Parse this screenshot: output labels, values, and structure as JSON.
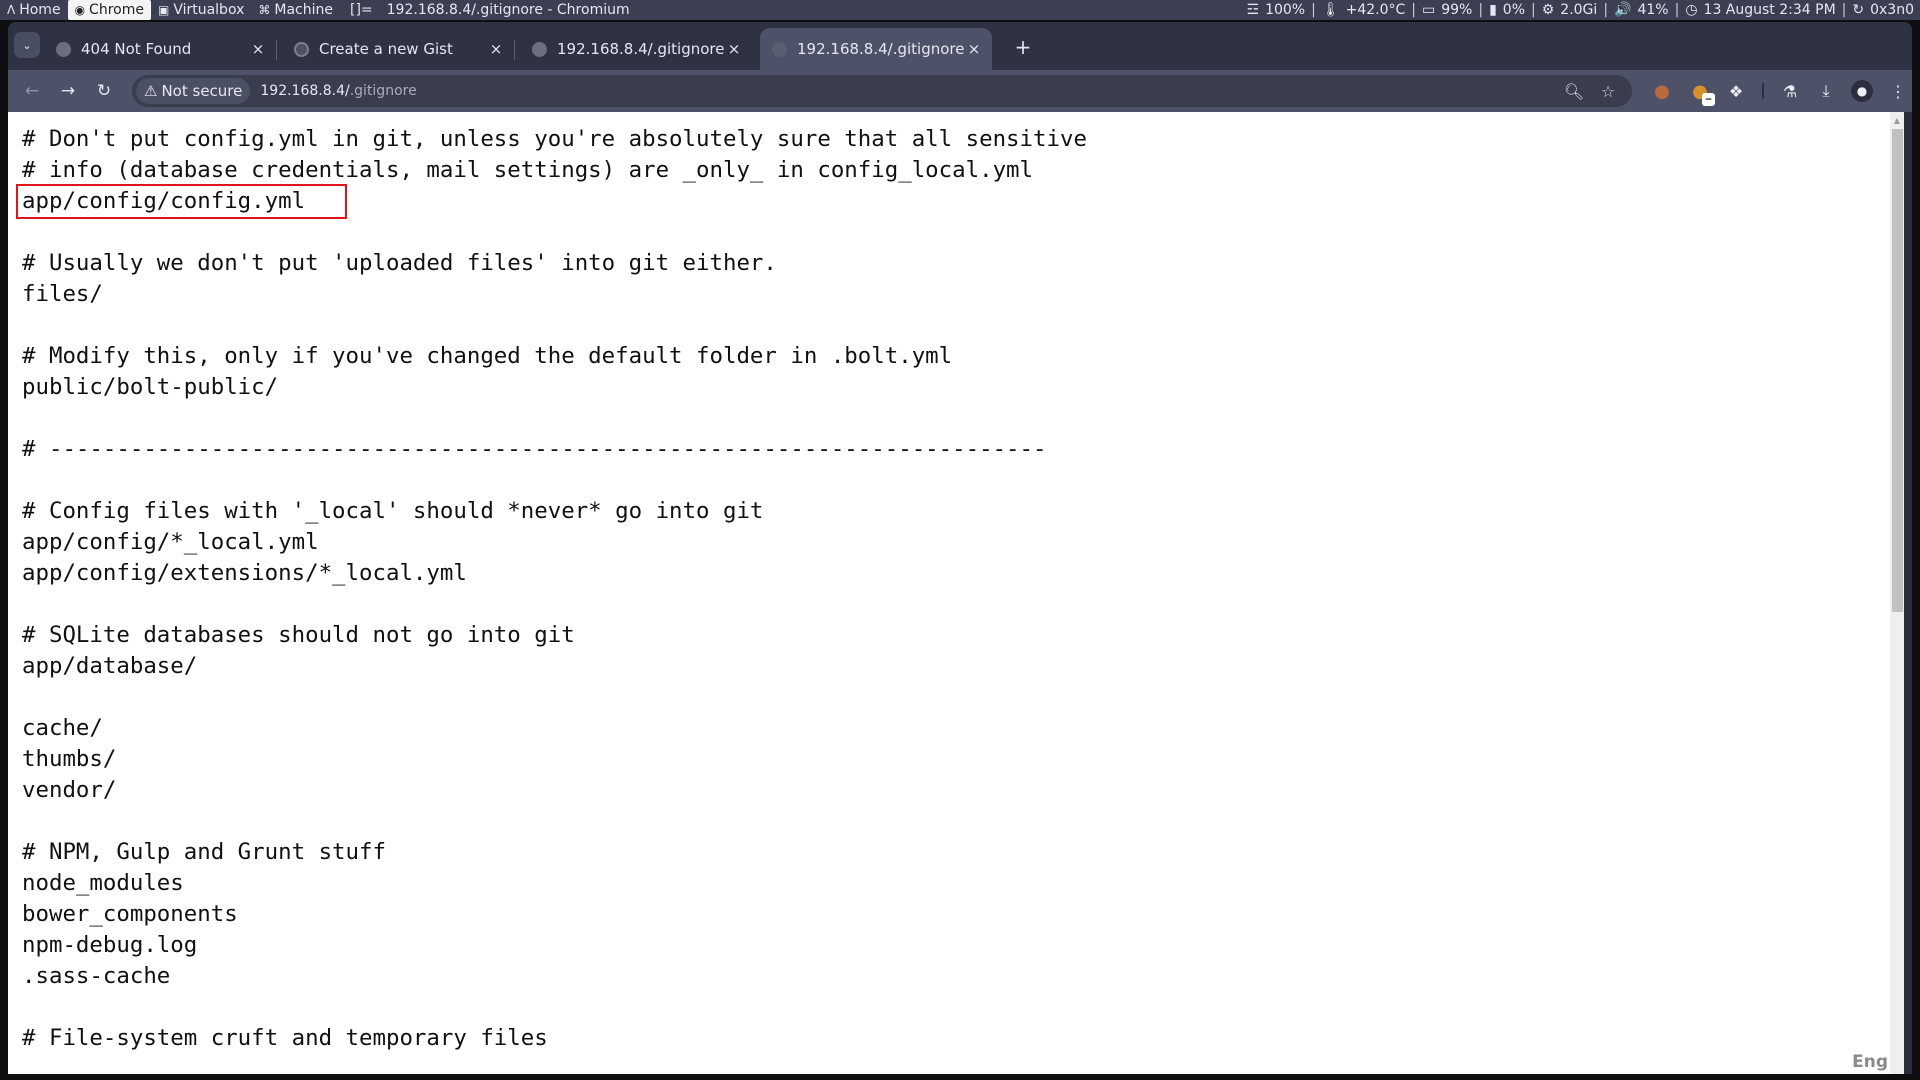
{
  "system_bar": {
    "workspaces": [
      {
        "icon": "arch-icon",
        "glyph": "Λ",
        "label": "Home",
        "active": false
      },
      {
        "icon": "chrome-icon",
        "glyph": "◉",
        "label": "Chrome",
        "active": true
      },
      {
        "icon": "monitor-icon",
        "glyph": "🖳",
        "label": "Virtualbox",
        "active": false
      },
      {
        "icon": "machine-icon",
        "glyph": "⌘",
        "label": "Machine",
        "active": false
      }
    ],
    "layout_symbol": "[]=",
    "window_title": "192.168.8.4/.gitignore - Chromium",
    "status": {
      "wifi": "100%",
      "temperature": "+42.0°C",
      "battery": "99%",
      "cpu": "0%",
      "memory": "2.0Gi",
      "volume": "41%",
      "datetime": "13 August 2:34 PM",
      "user": "0x3n0"
    }
  },
  "browser": {
    "tabs": [
      {
        "title": "404 Not Found",
        "favicon": "globe",
        "active": false
      },
      {
        "title": "Create a new Gist",
        "favicon": "github",
        "active": false
      },
      {
        "title": "192.168.8.4/.gitignore",
        "favicon": "globe",
        "active": false
      },
      {
        "title": "192.168.8.4/.gitignore",
        "favicon": "globe",
        "active": true
      }
    ],
    "new_tab_label": "+",
    "close_label": "×",
    "security_chip": "Not secure",
    "url_host": "192.168.8.4/",
    "url_path": ".gitignore"
  },
  "document": {
    "highlighted_line_index": 2,
    "highlight_color": "#e0151b",
    "lines": [
      "# Don't put config.yml in git, unless you're absolutely sure that all sensitive",
      "# info (database credentials, mail settings) are _only_ in config_local.yml",
      "app/config/config.yml",
      "",
      "# Usually we don't put 'uploaded files' into git either.",
      "files/",
      "",
      "# Modify this, only if you've changed the default folder in .bolt.yml",
      "public/bolt-public/",
      "",
      "# --------------------------------------------------------------------------",
      "",
      "# Config files with '_local' should *never* go into git",
      "app/config/*_local.yml",
      "app/config/extensions/*_local.yml",
      "",
      "# SQLite databases should not go into git",
      "app/database/",
      "",
      "cache/",
      "thumbs/",
      "vendor/",
      "",
      "# NPM, Gulp and Grunt stuff",
      "node_modules",
      "bower_components",
      "npm-debug.log",
      ".sass-cache",
      "",
      "# File-system cruft and temporary files"
    ]
  },
  "ime_indicator": "Eng"
}
